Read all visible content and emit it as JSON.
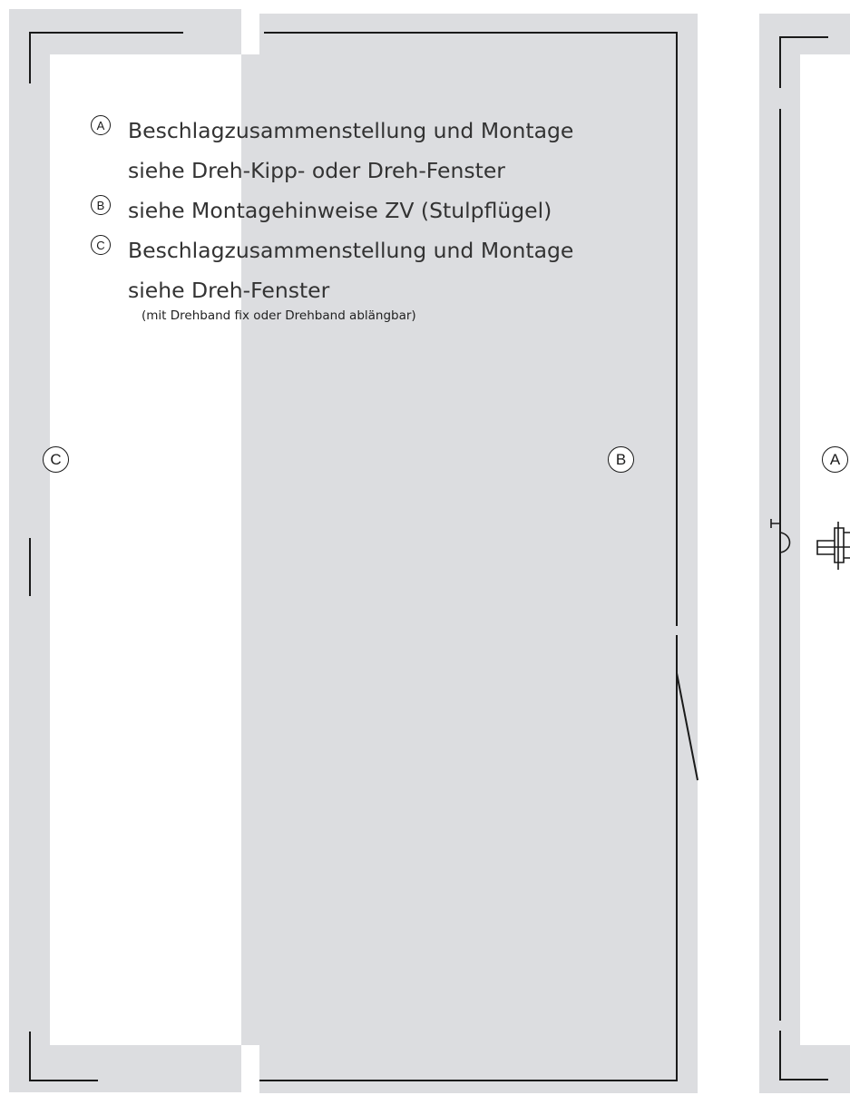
{
  "colors": {
    "frame_fill": "#dcdde0",
    "line": "#1a1a1a",
    "text": "#333333"
  },
  "legend": [
    {
      "marker": "A",
      "lines": [
        "Beschlagzusammenstellung und Montage",
        "siehe Dreh-Kipp- oder Dreh-Fenster"
      ]
    },
    {
      "marker": "B",
      "lines": [
        "siehe Montagehinweise ZV (Stulpflügel)"
      ]
    },
    {
      "marker": "C",
      "lines": [
        "Beschlagzusammenstellung und Montage",
        "siehe Dreh-Fenster"
      ]
    }
  ],
  "note": "(mit Drehband fix oder Drehband ablängbar)",
  "markers": {
    "left_sash": "C",
    "center_sash": "B",
    "right_sash": "A"
  }
}
